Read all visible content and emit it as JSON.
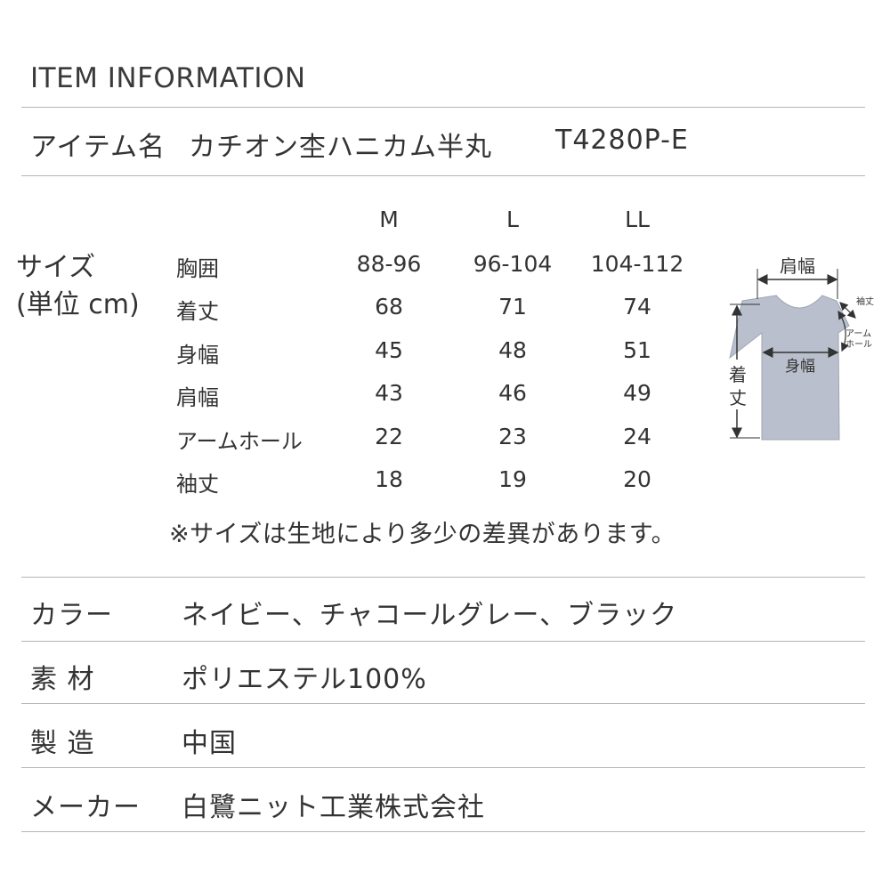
{
  "heading": "ITEM INFORMATION",
  "item": {
    "label": "アイテム名",
    "name": "カチオン杢ハニカム半丸",
    "code": "T4280P-E"
  },
  "size_table": {
    "title_line1": "サイズ",
    "title_line2": "(単位 cm)",
    "columns": [
      "M",
      "L",
      "LL"
    ],
    "rows": [
      {
        "label": "胸囲",
        "values": [
          "88-96",
          "96-104",
          "104-112"
        ]
      },
      {
        "label": "着丈",
        "values": [
          "68",
          "71",
          "74"
        ]
      },
      {
        "label": "身幅",
        "values": [
          "45",
          "48",
          "51"
        ]
      },
      {
        "label": "肩幅",
        "values": [
          "43",
          "46",
          "49"
        ]
      },
      {
        "label": "アームホール",
        "values": [
          "22",
          "23",
          "24"
        ]
      },
      {
        "label": "袖丈",
        "values": [
          "18",
          "19",
          "20"
        ]
      }
    ],
    "note": "※サイズは生地により多少の差異があります。"
  },
  "diagram": {
    "shoulder": "肩幅",
    "length_1": "着",
    "length_2": "丈",
    "body_width": "身幅",
    "sleeve": "袖丈",
    "armhole_1": "アーム",
    "armhole_2": "ホール",
    "shirt_color": "#b9bfcc"
  },
  "specs": [
    {
      "label": "カラー",
      "value": "ネイビー、チャコールグレー、ブラック"
    },
    {
      "label": "素 材",
      "value": "ポリエステル100%"
    },
    {
      "label": "製 造",
      "value": "中国"
    },
    {
      "label": "メーカー",
      "value": "白鷺ニット工業株式会社"
    }
  ]
}
